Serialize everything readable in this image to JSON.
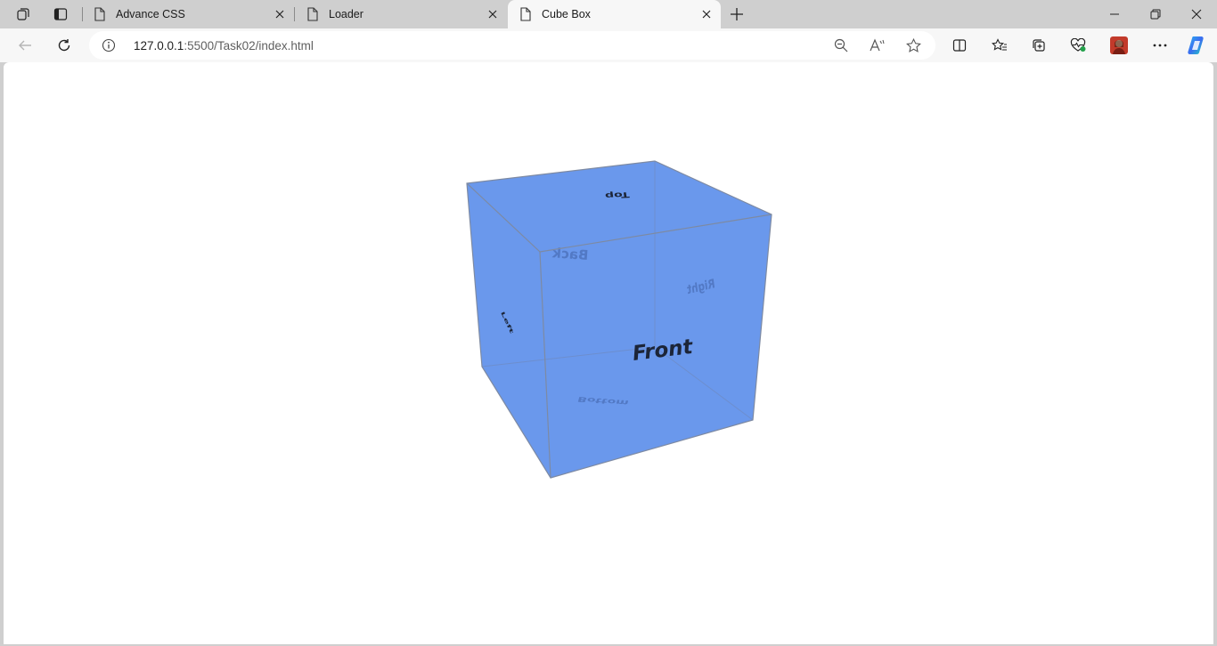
{
  "browser": {
    "tabs": [
      {
        "title": "Advance CSS",
        "active": false
      },
      {
        "title": "Loader",
        "active": false
      },
      {
        "title": "Cube Box",
        "active": true
      }
    ],
    "url_host": "127.0.0.1",
    "url_rest": ":5500/Task02/index.html"
  },
  "page": {
    "cube": {
      "face_color": "#6a98ec",
      "edge_color": "#7a8aa8",
      "labels": {
        "top": "Top",
        "back": "Back",
        "right": "Right",
        "left": "Left",
        "front": "Front",
        "bottom": "Bottom"
      }
    }
  },
  "icons": {
    "workspaces": "workspaces-icon",
    "tab_actions": "tab-actions-icon",
    "page": "page-icon",
    "close": "close-icon",
    "new_tab": "plus-icon",
    "minimize": "minimize-icon",
    "restore": "restore-icon",
    "window_close": "window-close-icon",
    "back": "back-arrow-icon",
    "refresh": "refresh-icon",
    "info": "info-icon",
    "zoom": "zoom-out-icon",
    "read_aloud": "read-aloud-icon",
    "favorite": "star-icon",
    "split": "split-screen-icon",
    "favorites": "favorites-icon",
    "collections": "collections-icon",
    "health": "browser-essentials-icon",
    "profile": "profile-avatar",
    "more": "more-icon",
    "copilot": "copilot-icon"
  }
}
